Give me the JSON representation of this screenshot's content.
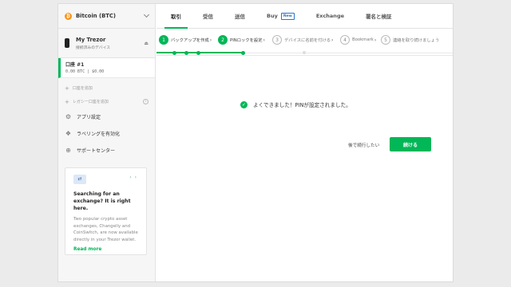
{
  "coin": {
    "icon": "bitcoin-icon",
    "label": "Bitcoin (BTC)"
  },
  "device": {
    "name": "My Trezor",
    "status": "接続済みのデバイス"
  },
  "account": {
    "title": "口座 #1",
    "balance": "0.00 BTC  |  $0.00"
  },
  "sidebar": {
    "add_account": "口座を追加",
    "add_legacy": "レガシー口座を追加",
    "items": [
      {
        "label": "アプリ設定",
        "icon": "gear-icon"
      },
      {
        "label": "ラベリングを有効化",
        "icon": "dropbox-icon"
      },
      {
        "label": "サポートセンター",
        "icon": "lifebuoy-icon"
      }
    ]
  },
  "promo": {
    "title": "Searching for an exchange? It is right here.",
    "body": "Two popular crypto asset exchanges, Changelly and CoinSwitch, are now available directly in your Trezor wallet.",
    "link": "Read more"
  },
  "tabs": [
    {
      "label": "取引",
      "active": true
    },
    {
      "label": "受信"
    },
    {
      "label": "送信"
    },
    {
      "label": "Buy",
      "badge": "New"
    },
    {
      "label": "Exchange"
    },
    {
      "label": "署名と検証"
    }
  ],
  "steps": [
    {
      "num": "1",
      "label": "バックアップを作成",
      "done": true
    },
    {
      "num": "2",
      "label": "PINロックを設定",
      "done": true
    },
    {
      "num": "3",
      "label": "デバイスに名前を付ける",
      "done": false
    },
    {
      "num": "4",
      "label": "Bookmark",
      "done": false
    },
    {
      "num": "5",
      "label": "連絡を取り続けましょう",
      "done": false
    }
  ],
  "message": "よくできました！PINが設定されました。",
  "buttons": {
    "later": "後で続行したい",
    "continue": "続ける"
  },
  "colors": {
    "accent": "#01b757",
    "badge": "#2776c9"
  }
}
